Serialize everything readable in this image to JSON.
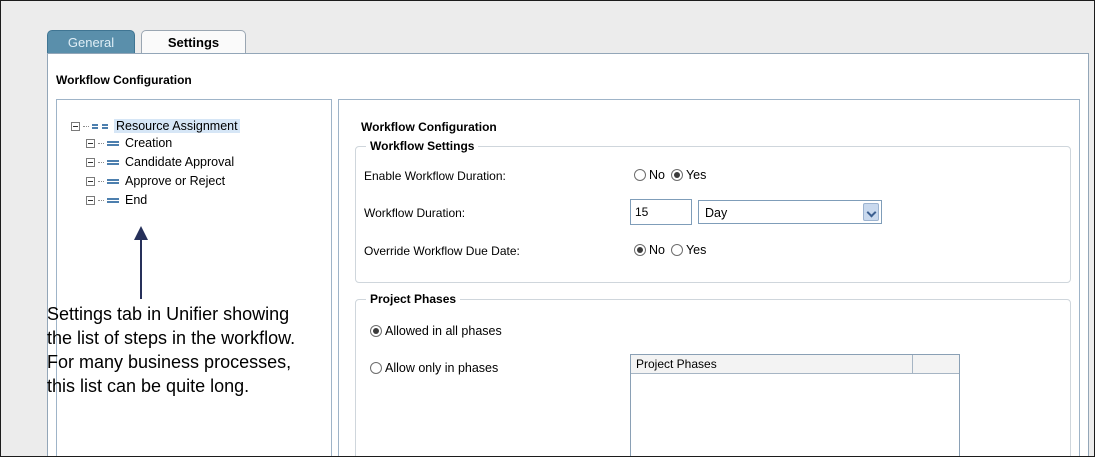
{
  "tabs": {
    "general": "General",
    "settings": "Settings"
  },
  "panel": {
    "title": "Workflow Configuration"
  },
  "tree": {
    "root": "Resource Assignment",
    "steps": [
      "Creation",
      "Candidate Approval",
      "Approve or Reject",
      "End"
    ]
  },
  "annotation": "Settings tab in Unifier showing the list of steps in the workflow. For many business processes, this list can be quite long.",
  "config": {
    "title": "Workflow Configuration",
    "workflow_settings": {
      "legend": "Workflow Settings",
      "enable_duration_label": "Enable Workflow Duration:",
      "duration_label": "Workflow Duration:",
      "duration_value": "15",
      "duration_unit": "Day",
      "override_label": "Override Workflow Due Date:",
      "no": "No",
      "yes": "Yes",
      "enable_duration_selected": "Yes",
      "override_selected": "No"
    },
    "project_phases": {
      "legend": "Project Phases",
      "allowed_all": "Allowed in all phases",
      "allow_only": "Allow only in phases",
      "grid_header": "Project Phases",
      "selected": "Allowed in all phases"
    }
  },
  "colors": {
    "tab_active": "#5a8fab",
    "accent": "#4d7fae",
    "selection": "#d6e6f6"
  },
  "icons": [
    "tree-collapse-icon",
    "tree-node-icon",
    "annotation-arrow-icon",
    "select-dropdown-arrow-icon"
  ]
}
